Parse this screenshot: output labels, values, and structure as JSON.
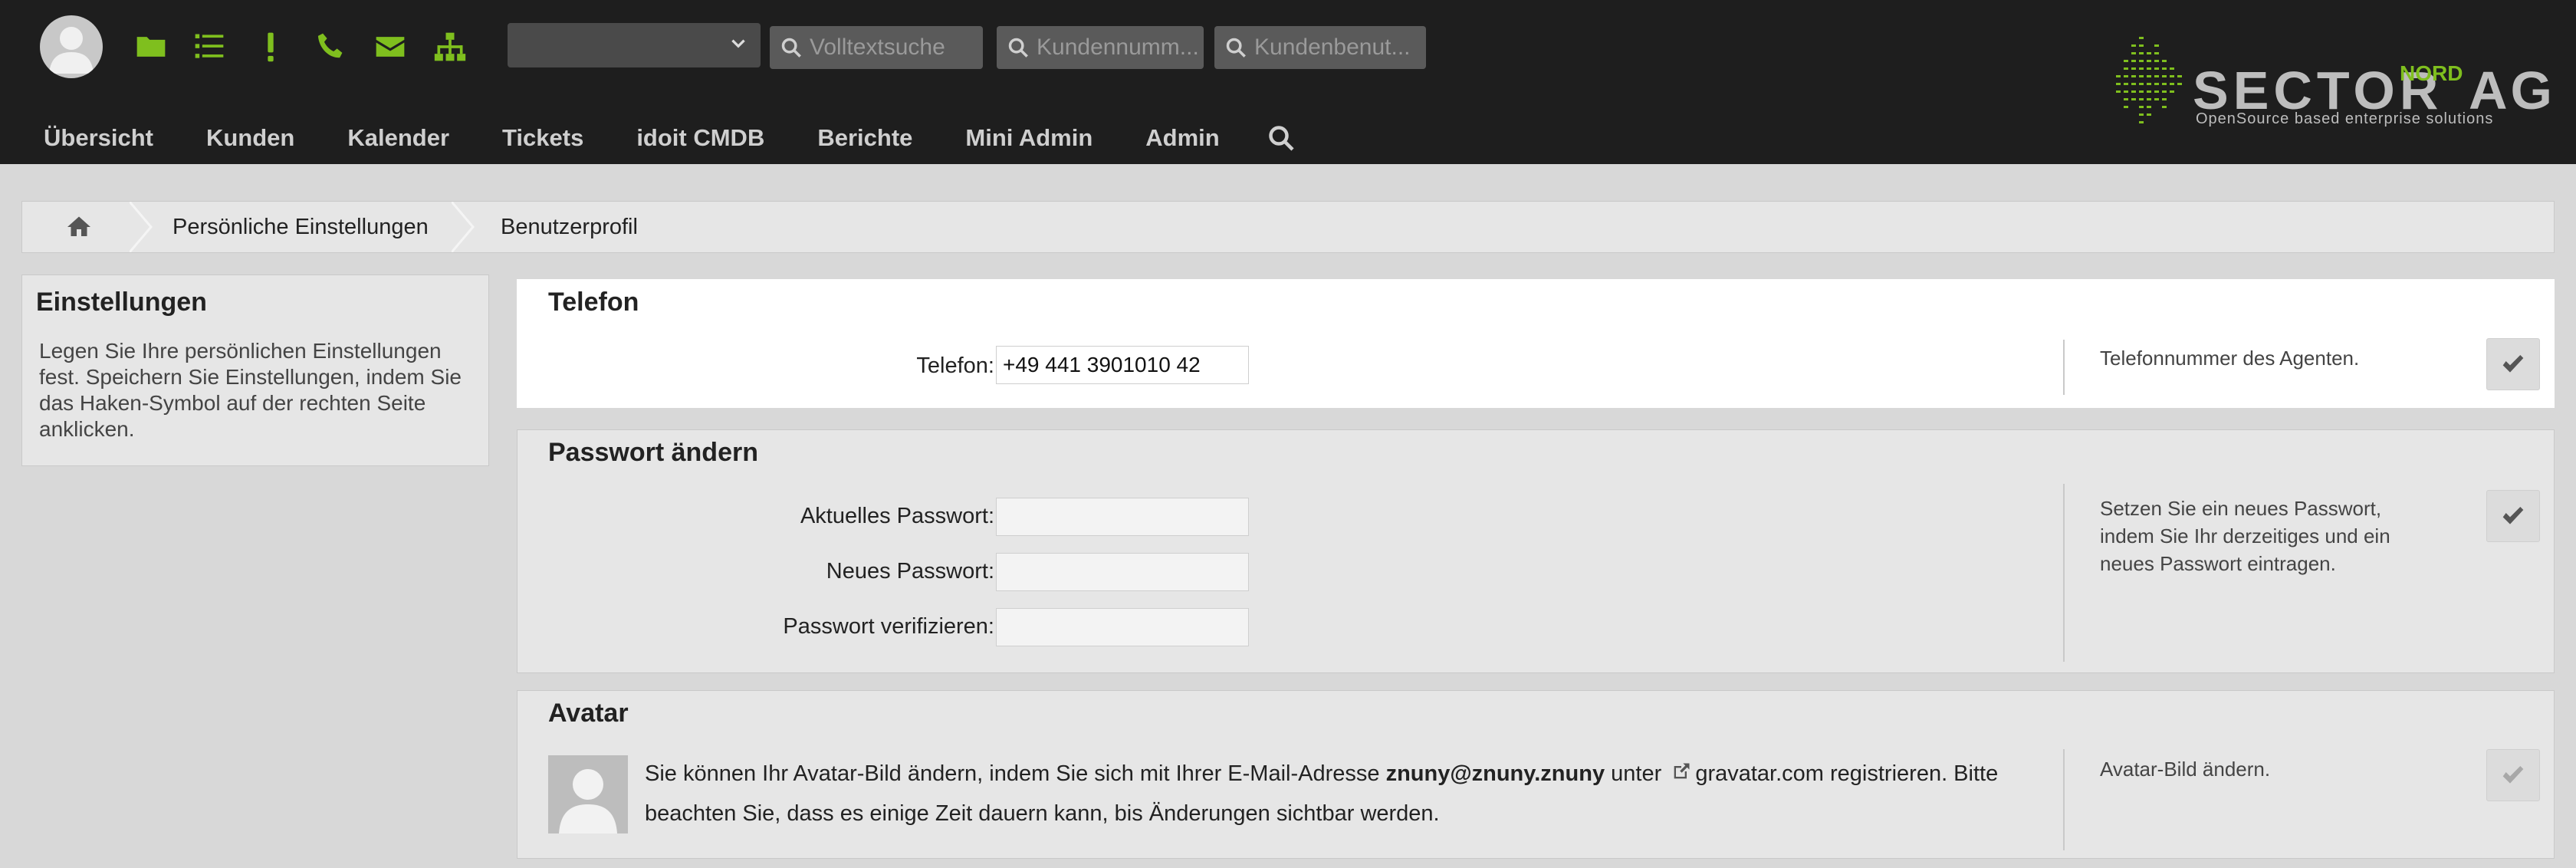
{
  "header": {
    "queue_select_value": "",
    "search_fulltext_placeholder": "Volltextsuche",
    "search_customer_number_placeholder": "Kundennumm...",
    "search_customer_user_placeholder": "Kundenbenut...",
    "icons": [
      "folder-icon",
      "list-icon",
      "exclamation-icon",
      "phone-icon",
      "envelope-icon",
      "sitemap-icon"
    ],
    "accent_color": "#7fbf1e",
    "logo": {
      "word": "SECTOR",
      "nord": "NORD",
      "ag": "AG",
      "tagline": "OpenSource based enterprise solutions"
    }
  },
  "nav": {
    "items": [
      "Übersicht",
      "Kunden",
      "Kalender",
      "Tickets",
      "idoit CMDB",
      "Berichte",
      "Mini Admin",
      "Admin"
    ]
  },
  "breadcrumb": {
    "items": [
      "Persönliche Einstellungen",
      "Benutzerprofil"
    ]
  },
  "sidebar": {
    "title": "Einstellungen",
    "text": "Legen Sie Ihre persönlichen Einstellungen fest. Speichern Sie Einstellungen, indem Sie das Haken-Symbol auf der rechten Seite anklicken."
  },
  "panels": {
    "phone": {
      "title": "Telefon",
      "label": "Telefon:",
      "value": "+49 441 3901010 42",
      "help": "Telefonnummer des Agenten."
    },
    "password": {
      "title": "Passwort ändern",
      "current_label": "Aktuelles Passwort:",
      "new_label": "Neues Passwort:",
      "verify_label": "Passwort verifizieren:",
      "current_value": "",
      "new_value": "",
      "verify_value": "",
      "help": "Setzen Sie ein neues Passwort, indem Sie Ihr derzeitiges und ein neues Passwort eintragen."
    },
    "avatar": {
      "title": "Avatar",
      "text_before": "Sie können Ihr Avatar-Bild ändern, indem Sie sich mit Ihrer E-Mail-Adresse",
      "email": "znuny@znuny.znuny",
      "text_unter": "unter",
      "link": "gravatar.com",
      "text_after": "registrieren. Bitte beachten Sie, dass es einige Zeit dauern kann, bis Änderungen sichtbar werden.",
      "help": "Avatar-Bild ändern."
    }
  }
}
